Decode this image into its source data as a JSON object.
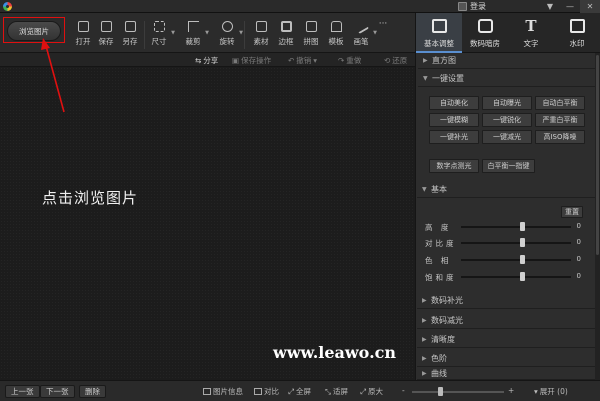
{
  "titlebar": {
    "login_label": "登录",
    "win_controls": [
      "▼",
      "—",
      "✕"
    ]
  },
  "toolbar": {
    "browse_label": "浏览图片",
    "tools": [
      {
        "label": "打开",
        "icon": "open-icon"
      },
      {
        "label": "保存",
        "icon": "save-icon"
      },
      {
        "label": "另存",
        "icon": "save-as-icon"
      },
      {
        "label": "尺寸",
        "icon": "resize-icon"
      },
      {
        "label": "裁剪",
        "icon": "crop-icon"
      },
      {
        "label": "旋转",
        "icon": "rotate-icon"
      },
      {
        "label": "素材",
        "icon": "material-icon"
      },
      {
        "label": "边框",
        "icon": "border-icon"
      },
      {
        "label": "拼图",
        "icon": "collage-icon"
      },
      {
        "label": "模板",
        "icon": "template-icon"
      },
      {
        "label": "画笔",
        "icon": "brush-icon"
      },
      {
        "label": "···",
        "icon": "more-icon"
      }
    ]
  },
  "subbar": {
    "share": "分享",
    "save_steps": "保存操作",
    "undo": "撤销",
    "redo": "重做",
    "compare": "还原"
  },
  "canvas": {
    "hint": "点击浏览图片",
    "watermark": "www.leawo.cn"
  },
  "bottombar": {
    "prev": "上一张",
    "next": "下一张",
    "delete": "删除",
    "info": "图片信息",
    "compare": "对比",
    "fullscreen": "全屏",
    "fit": "适屏",
    "original": "原大",
    "zoom_minus": "-",
    "zoom_plus": "+",
    "expand": "展开 (0)",
    "zoom_level": 0.3
  },
  "rpanel": {
    "tabs": [
      {
        "label": "基本调整",
        "icon": "adjust-icon"
      },
      {
        "label": "数码暗房",
        "icon": "darkroom-icon"
      },
      {
        "label": "文字",
        "icon": "text-icon"
      },
      {
        "label": "水印",
        "icon": "watermark-icon"
      }
    ],
    "histogram": "直方图",
    "one_click": "一键设置",
    "one_click_buttons": [
      "自动美化",
      "自动曝光",
      "自动白平衡",
      "一键模糊",
      "一键锐化",
      "严重白平衡",
      "一键补光",
      "一键减光",
      "高ISO降噪"
    ],
    "extra_buttons": [
      "数字点测光",
      "白平衡一指键"
    ],
    "basic": "基本",
    "reset": "重置",
    "sliders": [
      {
        "label": "高 度",
        "value": "0",
        "level": 0.55
      },
      {
        "label": "对比度",
        "value": "0",
        "level": 0.55
      },
      {
        "label": "色 相",
        "value": "0",
        "level": 0.55
      },
      {
        "label": "饱和度",
        "value": "0",
        "level": 0.55
      }
    ],
    "collapsed": [
      "数码补光",
      "数码减光",
      "清晰度",
      "色阶",
      "曲线"
    ]
  }
}
